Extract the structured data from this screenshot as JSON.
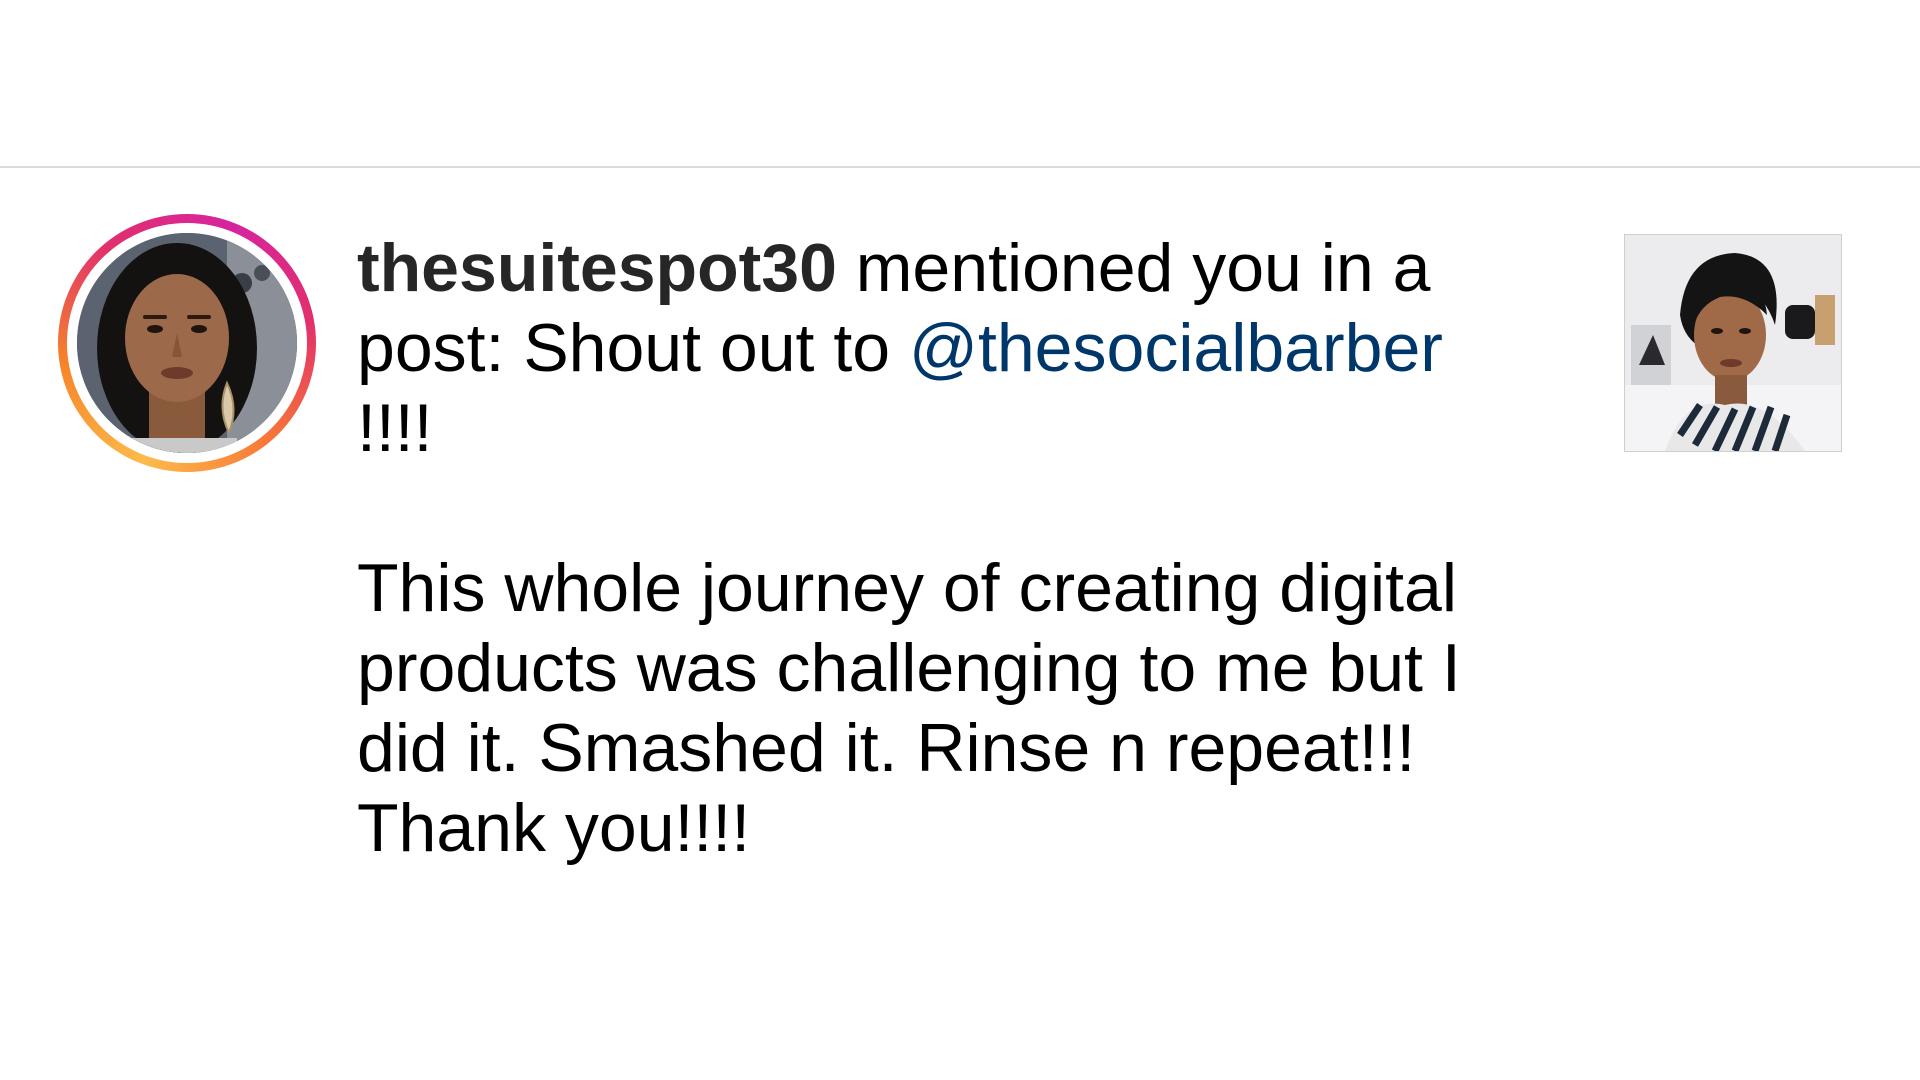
{
  "notification": {
    "username": "thesuitespot30",
    "action_text": " mentioned you in a post: Shout out to ",
    "mention": "@thesocialbarber",
    "mention_suffix": " !!!!",
    "message_lines": [
      "This whole journey of creating digital",
      "products was challenging to me but I",
      "did it. Smashed it. Rinse n repeat!!!",
      "Thank you!!!!"
    ],
    "avatar_icon": "profile-photo",
    "thumbnail_icon": "post-photo"
  },
  "colors": {
    "mention": "#00376b",
    "story_ring_start": "#fdbb4b",
    "story_ring_end": "#d6249f",
    "divider": "#dbdbdb"
  }
}
